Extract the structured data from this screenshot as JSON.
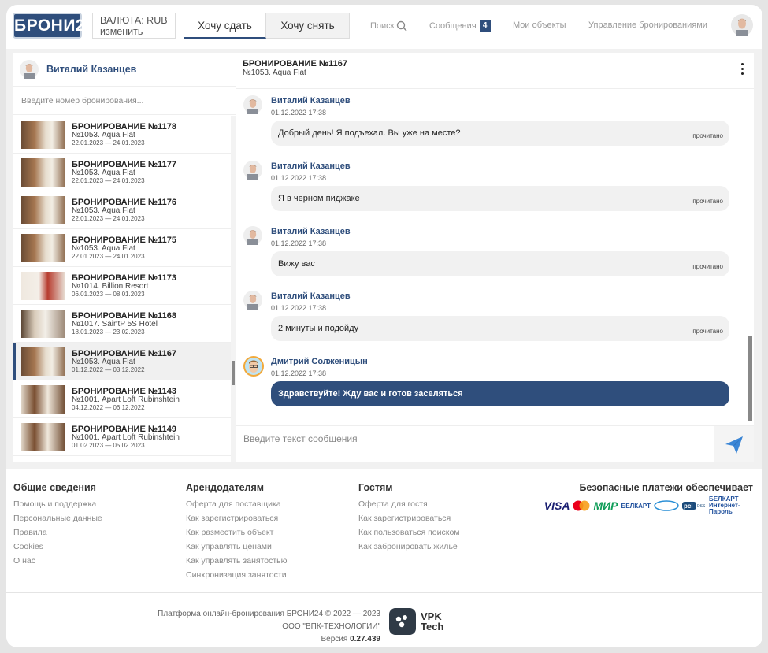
{
  "header": {
    "logo": "БРОНИ24",
    "currency_label": "ВАЛЮТА: RUB",
    "currency_change": "изменить",
    "tab_rent_out": "Хочу сдать",
    "tab_rent": "Хочу снять",
    "search": "Поиск",
    "messages": "Сообщения",
    "messages_count": "4",
    "my_objects": "Мои объекты",
    "manage_bookings": "Управление бронированиями"
  },
  "left": {
    "user_name": "Виталий Казанцев",
    "search_placeholder": "Введите номер бронирования...",
    "bookings": [
      {
        "title": "БРОНИРОВАНИЕ №1178",
        "place": "№1053. Aqua Flat",
        "dates": "22.01.2023 — 24.01.2023",
        "thumb": "loft"
      },
      {
        "title": "БРОНИРОВАНИЕ №1177",
        "place": "№1053. Aqua Flat",
        "dates": "22.01.2023 — 24.01.2023",
        "thumb": "loft"
      },
      {
        "title": "БРОНИРОВАНИЕ №1176",
        "place": "№1053. Aqua Flat",
        "dates": "22.01.2023 — 24.01.2023",
        "thumb": "loft"
      },
      {
        "title": "БРОНИРОВАНИЕ №1175",
        "place": "№1053. Aqua Flat",
        "dates": "22.01.2023 — 24.01.2023",
        "thumb": "loft"
      },
      {
        "title": "БРОНИРОВАНИЕ №1173",
        "place": "№1014. Billion Resort",
        "dates": "06.01.2023 — 08.01.2023",
        "thumb": "bedroom"
      },
      {
        "title": "БРОНИРОВАНИЕ №1168",
        "place": "№1017. SaintP 5S Hotel",
        "dates": "18.01.2023 — 23.02.2023",
        "thumb": "hall"
      },
      {
        "title": "БРОНИРОВАНИЕ №1167",
        "place": "№1053. Aqua Flat",
        "dates": "01.12.2022 — 03.12.2022",
        "thumb": "loft"
      },
      {
        "title": "БРОНИРОВАНИЕ №1143",
        "place": "№1001. Apart Loft Rubinshtein",
        "dates": "04.12.2022 — 06.12.2022",
        "thumb": "apart"
      },
      {
        "title": "БРОНИРОВАНИЕ №1149",
        "place": "№1001. Apart Loft Rubinshtein",
        "dates": "01.02.2023 — 05.02.2023",
        "thumb": "apart"
      }
    ]
  },
  "chat": {
    "title": "БРОНИРОВАНИЕ №1167",
    "subtitle": "№1053. Aqua Flat",
    "messages": [
      {
        "author": "Виталий Казанцев",
        "time": "01.12.2022 17:38",
        "text": "Добрый день! Я подъехал. Вы уже на месте?",
        "status": "прочитано",
        "own": false
      },
      {
        "author": "Виталий Казанцев",
        "time": "01.12.2022 17:38",
        "text": "Я в черном пиджаке",
        "status": "прочитано",
        "own": false
      },
      {
        "author": "Виталий Казанцев",
        "time": "01.12.2022 17:38",
        "text": "Вижу вас",
        "status": "прочитано",
        "own": false
      },
      {
        "author": "Виталий Казанцев",
        "time": "01.12.2022 17:38",
        "text": "2 минуты и подойду",
        "status": "прочитано",
        "own": false
      },
      {
        "author": "Дмитрий Солженицын",
        "time": "01.12.2022 17:38",
        "text": "Здравствуйте! Жду вас и готов заселяться",
        "status": "",
        "own": true
      }
    ],
    "input_placeholder": "Введите текст сообщения"
  },
  "footer": {
    "col1": {
      "title": "Общие сведения",
      "links": [
        "Помощь и поддержка",
        "Персональные данные",
        "Правила",
        "Cookies",
        "О нас"
      ]
    },
    "col2": {
      "title": "Арендодателям",
      "links": [
        "Оферта для поставщика",
        "Как зарегистрироваться",
        "Как разместить объект",
        "Как управлять ценами",
        "Как управлять занятостью",
        "Синхронизация занятости"
      ]
    },
    "col3": {
      "title": "Гостям",
      "links": [
        "Оферта для гостя",
        "Как зарегистрироваться",
        "Как пользоваться поиском",
        "Как забронировать жилье"
      ]
    },
    "payments_title": "Безопасные платежи обеспечивает",
    "payment_logos": [
      "VISA",
      "МИР",
      "БЕЛКАРТ",
      "БЕЛКАРТ Интернет-Пароль"
    ],
    "copyright": "Платформа онлайн-бронирования БРОНИ24 © 2022 — 2023",
    "company": "ООО \"ВПК-ТЕХНОЛОГИИ\"",
    "version_label": "Версия",
    "version": "0.27.439",
    "vpk_line1": "VPK",
    "vpk_line2": "Tech"
  },
  "colors": {
    "brand": "#2f4e7c",
    "panel_bg": "#f1f1f1"
  }
}
